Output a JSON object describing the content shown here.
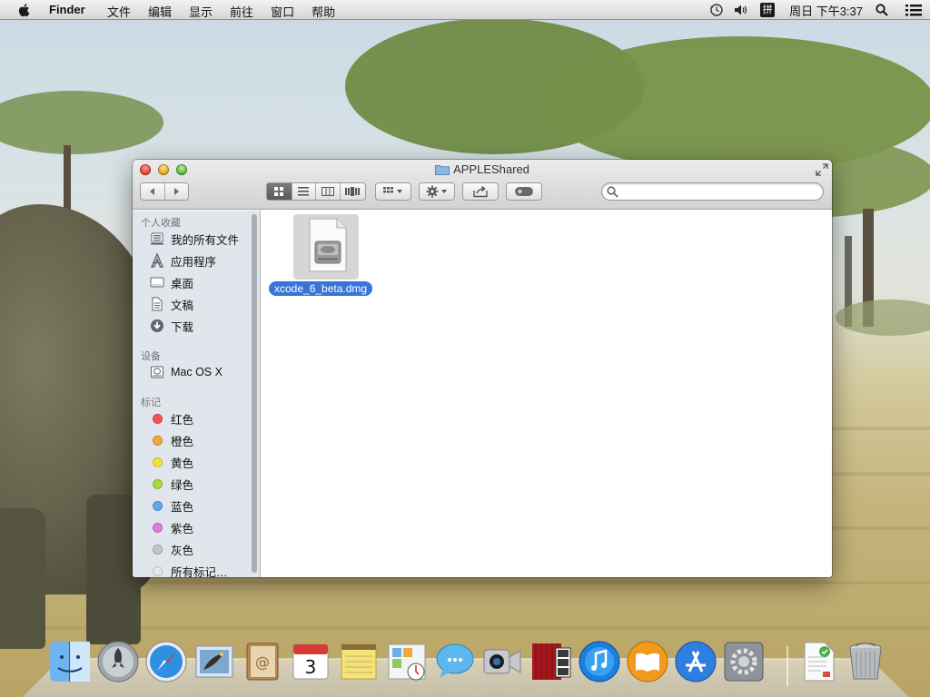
{
  "menubar": {
    "app_name": "Finder",
    "menus": [
      "文件",
      "编辑",
      "显示",
      "前往",
      "窗口",
      "帮助"
    ],
    "input_method": "拼",
    "clock": "周日 下午3:37"
  },
  "window": {
    "title": "APPLEShared",
    "search": {
      "value": "",
      "placeholder": ""
    },
    "toolbar": {
      "view_modes": [
        "icon-view",
        "list-view",
        "column-view",
        "cover-flow-view"
      ],
      "active_view": "icon-view"
    }
  },
  "sidebar": {
    "favorites_header": "个人收藏",
    "favorites": [
      {
        "label": "我的所有文件",
        "icon": "all-files-icon"
      },
      {
        "label": "应用程序",
        "icon": "applications-icon"
      },
      {
        "label": "桌面",
        "icon": "desktop-icon"
      },
      {
        "label": "文稿",
        "icon": "documents-icon"
      },
      {
        "label": "下载",
        "icon": "downloads-icon"
      }
    ],
    "devices_header": "设备",
    "devices": [
      {
        "label": "Mac OS X",
        "icon": "hard-drive-icon"
      }
    ],
    "tags_header": "标记",
    "tags": [
      {
        "label": "红色",
        "color": "#f2545b"
      },
      {
        "label": "橙色",
        "color": "#f8a33c"
      },
      {
        "label": "黄色",
        "color": "#f4e23a"
      },
      {
        "label": "绿色",
        "color": "#a7d93f"
      },
      {
        "label": "蓝色",
        "color": "#5aa8ec"
      },
      {
        "label": "紫色",
        "color": "#d97ee3"
      },
      {
        "label": "灰色",
        "color": "#c4c4c4"
      },
      {
        "label": "所有标记…",
        "color": "#e8e8e8"
      }
    ]
  },
  "files": [
    {
      "name": "xcode_6_beta.dmg",
      "selected": true,
      "icon": "disk-image-icon"
    }
  ],
  "dock": {
    "items": [
      "finder-icon",
      "launchpad-icon",
      "safari-icon",
      "mail-icon",
      "contacts-icon",
      "calendar-icon",
      "notes-icon",
      "reminders-icon",
      "messages-icon",
      "facetime-icon",
      "photo-booth-icon",
      "itunes-icon",
      "ibooks-icon",
      "app-store-icon",
      "system-preferences-icon",
      "document-icon",
      "trash-icon"
    ],
    "calendar_day": "3"
  }
}
